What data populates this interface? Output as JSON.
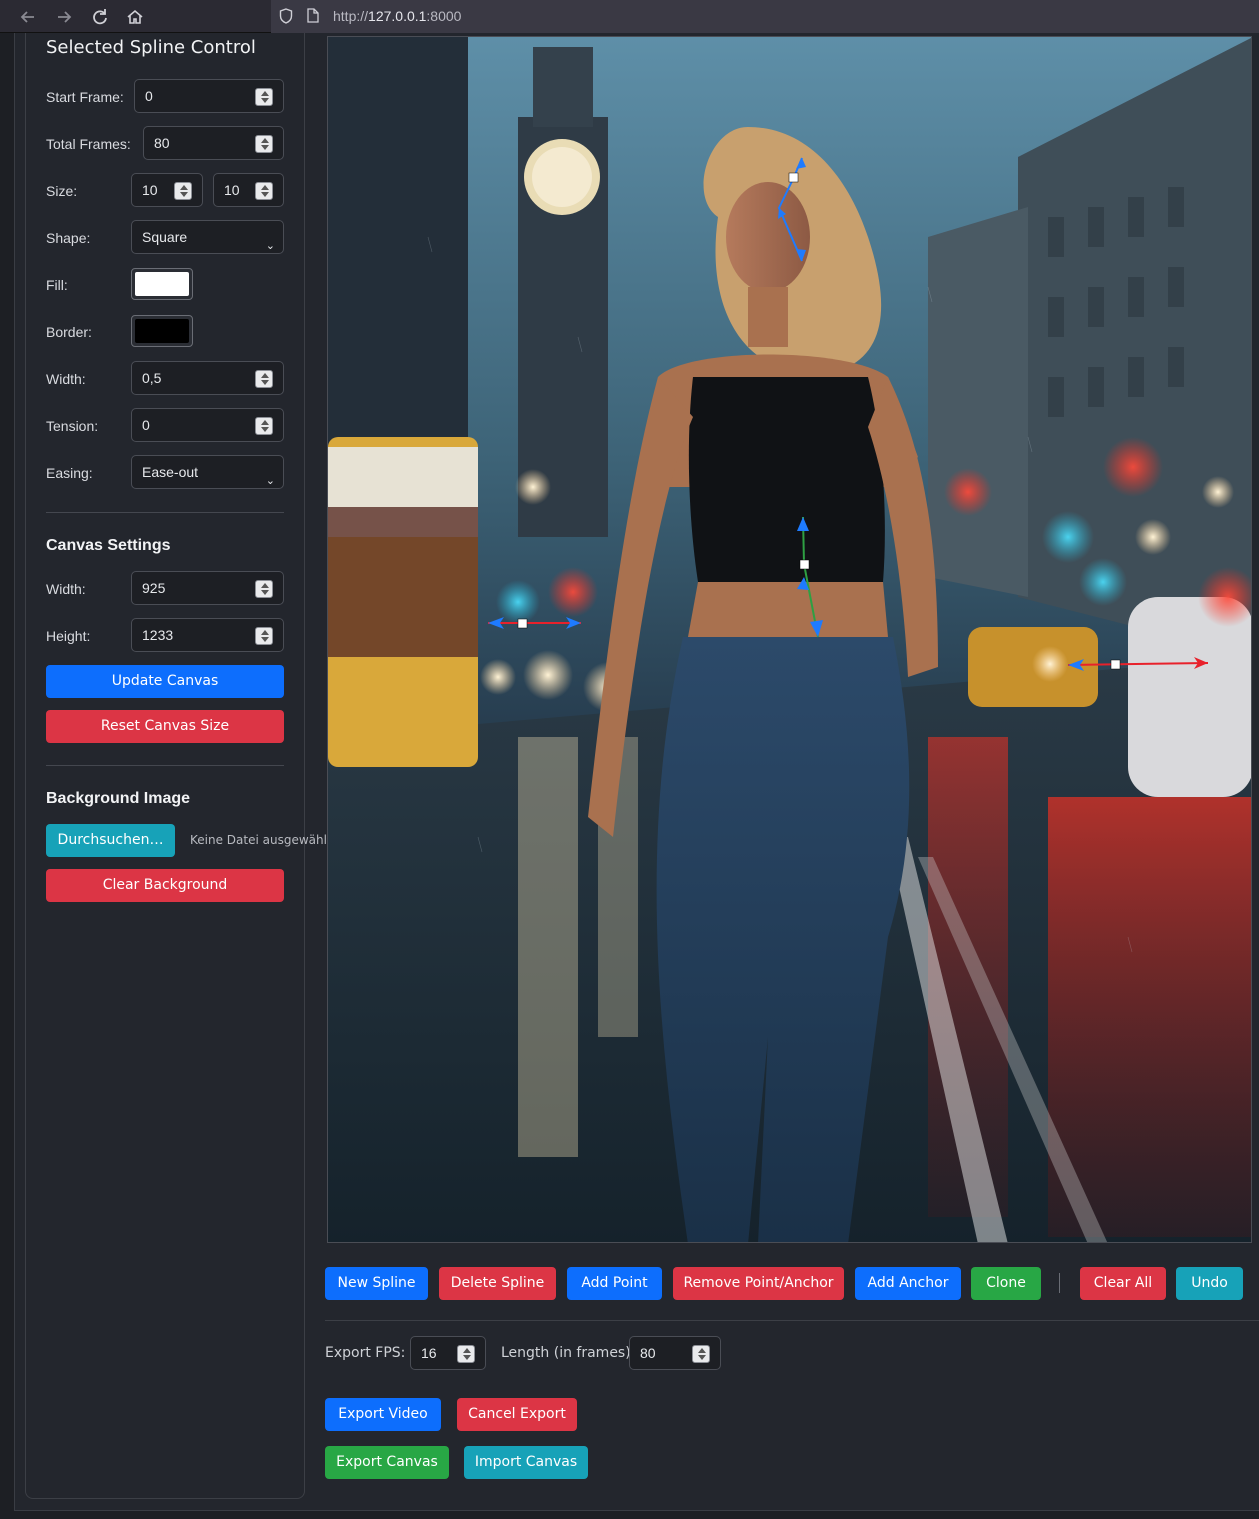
{
  "browser": {
    "url_prefix": "http://",
    "url_host": "127.0.0.1",
    "url_suffix": ":8000",
    "nav_icons": [
      "back-arrow-icon",
      "forward-arrow-icon",
      "reload-icon",
      "home-icon",
      "shield-icon",
      "page-icon"
    ]
  },
  "spline_control": {
    "title": "Selected Spline Control",
    "start_frame_label": "Start Frame:",
    "start_frame": "0",
    "total_frames_label": "Total Frames:",
    "total_frames": "80",
    "size_label": "Size:",
    "size_w": "10",
    "size_h": "10",
    "shape_label": "Shape:",
    "shape": "Square",
    "fill_label": "Fill:",
    "fill_color": "#ffffff",
    "border_label": "Border:",
    "border_color": "#000000",
    "width_label": "Width:",
    "width": "0,5",
    "tension_label": "Tension:",
    "tension": "0",
    "easing_label": "Easing:",
    "easing": "Ease-out"
  },
  "canvas_settings": {
    "title": "Canvas Settings",
    "width_label": "Width:",
    "width": "925",
    "height_label": "Height:",
    "height": "1233",
    "update_button": "Update Canvas",
    "reset_button": "Reset Canvas Size"
  },
  "background_image": {
    "title": "Background Image",
    "browse_button": "Durchsuchen…",
    "file_status": "Keine Datei ausgewählt.",
    "clear_button": "Clear Background"
  },
  "toolbar": {
    "new_spline": "New Spline",
    "delete_spline": "Delete Spline",
    "add_point": "Add Point",
    "remove_point": "Remove Point/Anchor",
    "add_anchor": "Add Anchor",
    "clone": "Clone",
    "clear_all": "Clear All",
    "undo": "Undo"
  },
  "export": {
    "fps_label": "Export FPS:",
    "fps": "16",
    "length_label": "Length (in frames):",
    "length": "80",
    "export_video": "Export Video",
    "cancel_export": "Cancel Export",
    "export_canvas": "Export Canvas",
    "import_canvas": "Import Canvas"
  },
  "colors": {
    "primary": "#0d6efd",
    "danger": "#dc3545",
    "success": "#28a745",
    "info": "#17a2b8",
    "spline_blue": "#1e7bff",
    "spline_red": "#e8212b",
    "spline_green": "#2ea043"
  }
}
